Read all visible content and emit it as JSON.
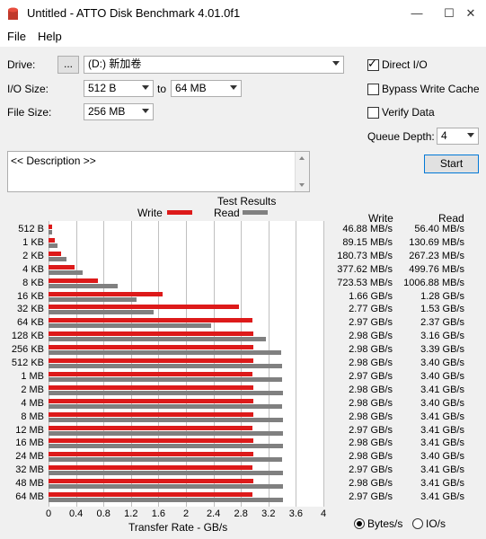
{
  "window": {
    "title": "Untitled - ATTO Disk Benchmark 4.01.0f1",
    "minimize": "—",
    "maximize": "☐",
    "close": "✕"
  },
  "menu": [
    "File",
    "Help"
  ],
  "controls": {
    "drive_label": "Drive:",
    "drive_browse": "...",
    "drive_value": "(D:) 新加卷",
    "io_size_label": "I/O Size:",
    "io_size_from": "512 B",
    "io_size_to_label": "to",
    "io_size_to": "64 MB",
    "file_size_label": "File Size:",
    "file_size_value": "256 MB",
    "direct_io": {
      "label": "Direct I/O",
      "checked": true
    },
    "bypass_write_cache": {
      "label": "Bypass Write Cache",
      "checked": false
    },
    "verify_data": {
      "label": "Verify Data",
      "checked": false
    },
    "queue_depth_label": "Queue Depth:",
    "queue_depth_value": "4",
    "start_label": "Start",
    "description": "<< Description >>"
  },
  "results": {
    "title": "Test Results",
    "legend_write": "Write",
    "legend_read": "Read",
    "col_write": "Write",
    "col_read": "Read",
    "write_values": [
      "46.88 MB/s",
      "89.15 MB/s",
      "180.73 MB/s",
      "377.62 MB/s",
      "723.53 MB/s",
      "1.66 GB/s",
      "2.77 GB/s",
      "2.97 GB/s",
      "2.98 GB/s",
      "2.98 GB/s",
      "2.98 GB/s",
      "2.97 GB/s",
      "2.98 GB/s",
      "2.98 GB/s",
      "2.98 GB/s",
      "2.97 GB/s",
      "2.98 GB/s",
      "2.98 GB/s",
      "2.97 GB/s",
      "2.98 GB/s",
      "2.97 GB/s"
    ],
    "read_values": [
      "56.40 MB/s",
      "130.69 MB/s",
      "267.23 MB/s",
      "499.76 MB/s",
      "1006.88 MB/s",
      "1.28 GB/s",
      "1.53 GB/s",
      "2.37 GB/s",
      "3.16 GB/s",
      "3.39 GB/s",
      "3.40 GB/s",
      "3.40 GB/s",
      "3.41 GB/s",
      "3.40 GB/s",
      "3.41 GB/s",
      "3.41 GB/s",
      "3.41 GB/s",
      "3.40 GB/s",
      "3.41 GB/s",
      "3.41 GB/s",
      "3.41 GB/s"
    ],
    "unit_bytes": "Bytes/s",
    "unit_io": "IO/s",
    "unit_selected": "Bytes/s"
  },
  "colors": {
    "write": "#dd1a1a",
    "read": "#808080"
  },
  "chart_data": {
    "type": "bar",
    "orientation": "horizontal",
    "xlabel": "Transfer Rate - GB/s",
    "xlim": [
      0,
      4
    ],
    "xticks": [
      "0",
      "0.4",
      "0.8",
      "1.2",
      "1.6",
      "2",
      "2.4",
      "2.8",
      "3.2",
      "3.6",
      "4"
    ],
    "categories": [
      "512 B",
      "1 KB",
      "2 KB",
      "4 KB",
      "8 KB",
      "16 KB",
      "32 KB",
      "64 KB",
      "128 KB",
      "256 KB",
      "512 KB",
      "1 MB",
      "2 MB",
      "4 MB",
      "8 MB",
      "12 MB",
      "16 MB",
      "24 MB",
      "32 MB",
      "48 MB",
      "64 MB"
    ],
    "series": [
      {
        "name": "Write",
        "values": [
          0.047,
          0.089,
          0.181,
          0.378,
          0.724,
          1.66,
          2.77,
          2.97,
          2.98,
          2.98,
          2.98,
          2.97,
          2.98,
          2.98,
          2.98,
          2.97,
          2.98,
          2.98,
          2.97,
          2.98,
          2.97
        ]
      },
      {
        "name": "Read",
        "values": [
          0.056,
          0.131,
          0.267,
          0.5,
          1.007,
          1.28,
          1.53,
          2.37,
          3.16,
          3.39,
          3.4,
          3.4,
          3.41,
          3.4,
          3.41,
          3.41,
          3.41,
          3.4,
          3.41,
          3.41,
          3.41
        ]
      }
    ],
    "grid": true,
    "legend": "top"
  }
}
